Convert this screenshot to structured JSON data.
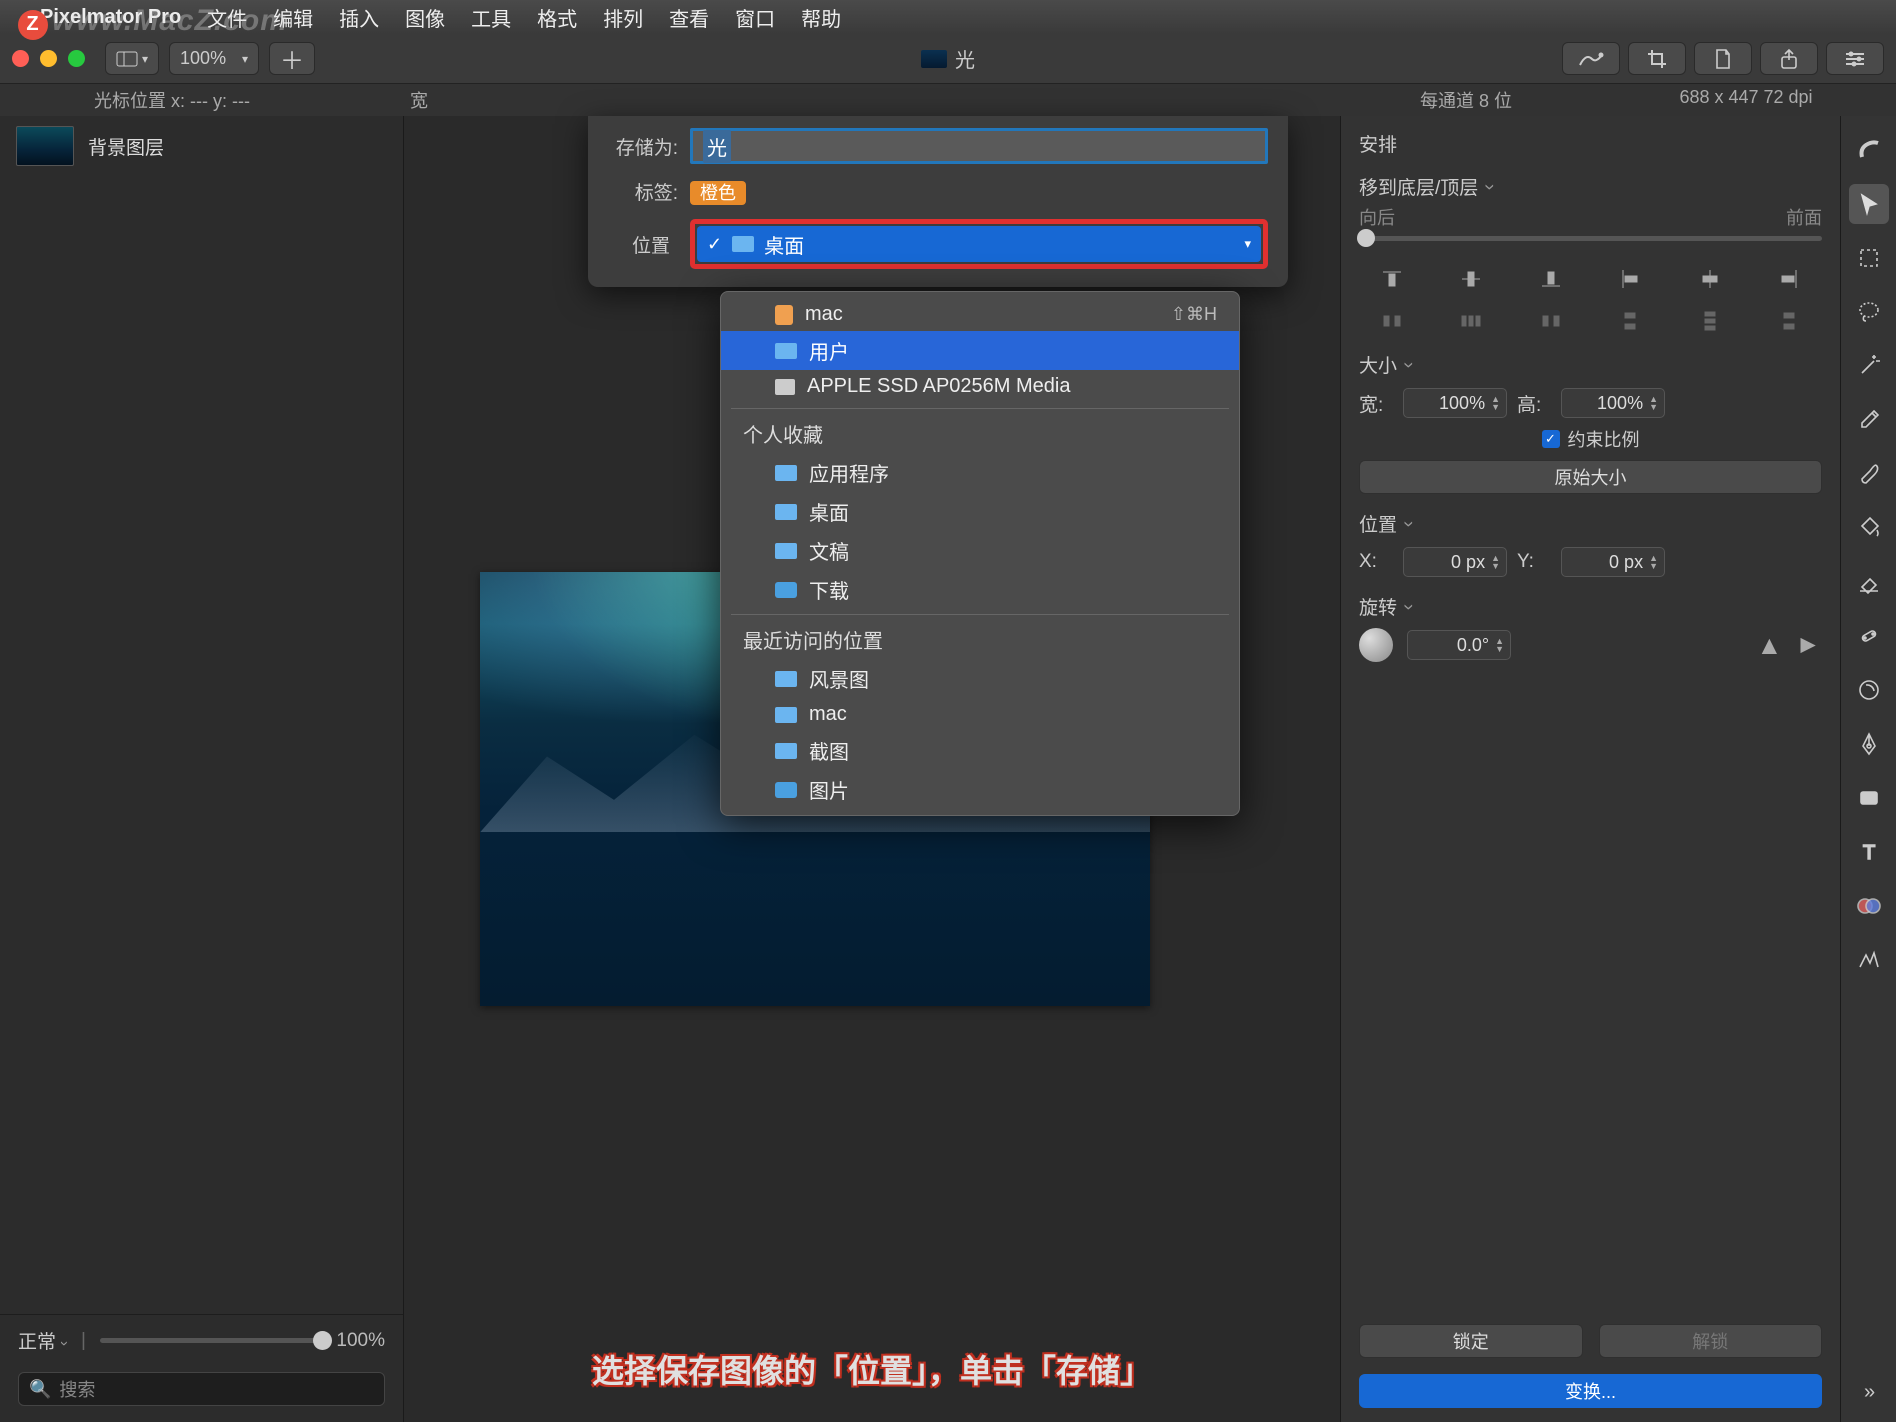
{
  "watermark": "www.MacZ.com",
  "menubar": {
    "app": "Pixelmator Pro",
    "items": [
      "文件",
      "编辑",
      "插入",
      "图像",
      "工具",
      "格式",
      "排列",
      "查看",
      "窗口",
      "帮助"
    ]
  },
  "toolbar": {
    "zoom": "100%",
    "doc_title": "光"
  },
  "info": {
    "cursor": "光标位置 x:  ---      y:  ---",
    "width_label": "宽",
    "bits": "每通道 8 位",
    "dims": "688 x 447 72 dpi"
  },
  "sidebar": {
    "layer_name": "背景图层",
    "blend_mode": "正常",
    "opacity": "100%",
    "search_placeholder": "搜索"
  },
  "save_dialog": {
    "save_as_label": "存储为:",
    "save_as_value": "光",
    "tag_label": "标签:",
    "tag_value": "橙色",
    "location_label": "位置",
    "selected_location": "桌面"
  },
  "dropdown": {
    "section_top": [
      {
        "label": "mac",
        "icon": "mac",
        "shortcut": "⇧⌘H"
      },
      {
        "label": "用户",
        "icon": "folder"
      },
      {
        "label": "APPLE SSD AP0256M Media",
        "icon": "hdd"
      }
    ],
    "header_fav": "个人收藏",
    "favorites": [
      {
        "label": "应用程序",
        "icon": "folder"
      },
      {
        "label": "桌面",
        "icon": "folder"
      },
      {
        "label": "文稿",
        "icon": "folder"
      },
      {
        "label": "下载",
        "icon": "camera"
      }
    ],
    "header_recent": "最近访问的位置",
    "recent": [
      {
        "label": "风景图",
        "icon": "folder"
      },
      {
        "label": "mac",
        "icon": "folder"
      },
      {
        "label": "截图",
        "icon": "folder"
      },
      {
        "label": "图片",
        "icon": "camera"
      }
    ]
  },
  "right_panel": {
    "title": "安排",
    "move_label": "移到底层/顶层",
    "back": "向后",
    "front": "前面",
    "size_label": "大小",
    "w_label": "宽:",
    "w_value": "100%",
    "h_label": "高:",
    "h_value": "100%",
    "constrain": "约束比例",
    "original_size": "原始大小",
    "position_label": "位置",
    "x_label": "X:",
    "x_value": "0 px",
    "y_label": "Y:",
    "y_value": "0 px",
    "rotate_label": "旋转",
    "rotate_value": "0.0°",
    "lock": "锁定",
    "unlock": "解锁",
    "transform": "变换..."
  },
  "caption": "选择保存图像的「位置」，单击「存储」"
}
